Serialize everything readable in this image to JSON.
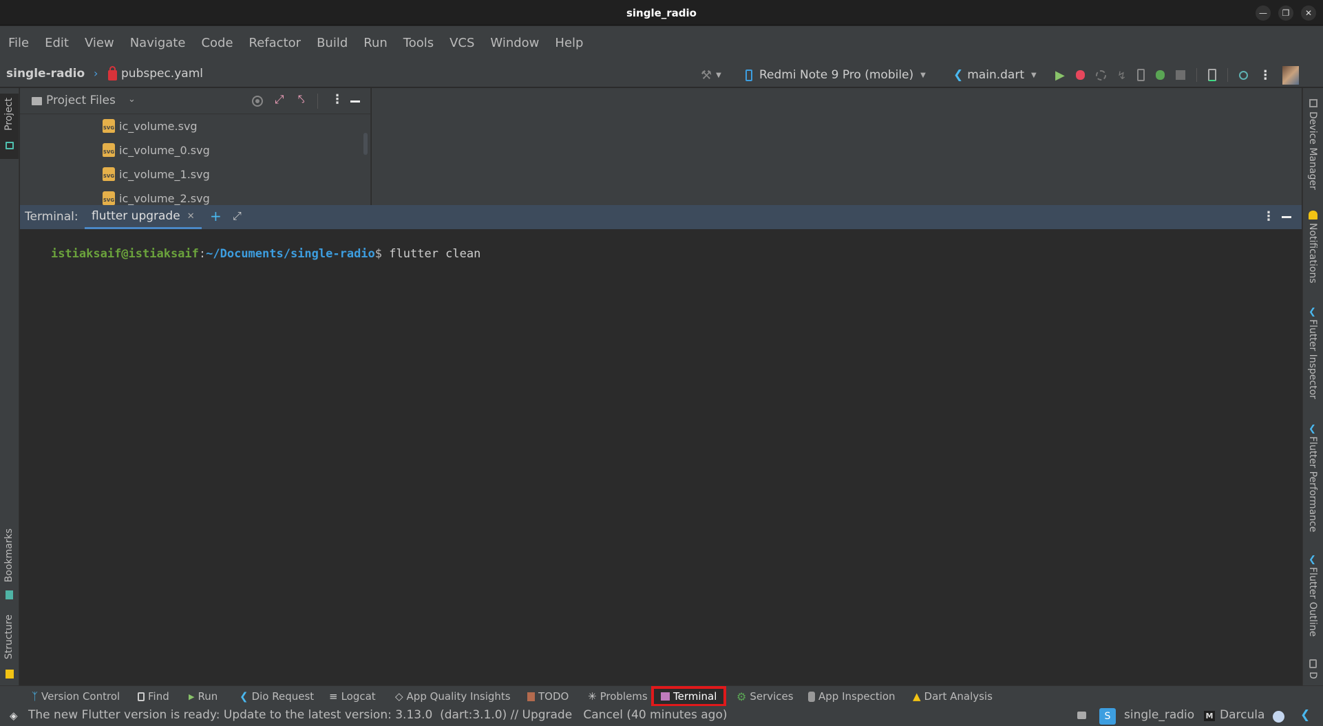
{
  "window": {
    "title": "single_radio",
    "controls": [
      "minimize",
      "restore",
      "close"
    ]
  },
  "menu": [
    "File",
    "Edit",
    "View",
    "Navigate",
    "Code",
    "Refactor",
    "Build",
    "Run",
    "Tools",
    "VCS",
    "Window",
    "Help"
  ],
  "breadcrumb": {
    "project": "single-radio",
    "separator": "›",
    "file": "pubspec.yaml"
  },
  "toolbar": {
    "device": "Redmi Note 9 Pro (mobile)",
    "run_config": "main.dart",
    "icons": [
      "hammer-icon",
      "run-icon",
      "debug-icon",
      "profile-icon",
      "hot-reload-icon",
      "flutter-device-icon",
      "attach-debugger-icon",
      "stop-icon",
      "device-manager-icon",
      "search-icon",
      "more-icon",
      "avatar"
    ]
  },
  "left_strip": {
    "top": [
      {
        "label": "Project",
        "icon": "laptop-icon"
      }
    ],
    "bottom": [
      {
        "label": "Bookmarks",
        "icon": "bookmark-icon"
      },
      {
        "label": "Structure",
        "icon": "structure-icon"
      }
    ]
  },
  "right_strip": [
    {
      "label": "Device Manager",
      "icon": "device-manager-icon"
    },
    {
      "label": "Notifications",
      "icon": "bell-icon"
    },
    {
      "label": "Flutter Inspector",
      "icon": "flutter-icon"
    },
    {
      "label": "Flutter Performance",
      "icon": "flutter-icon"
    },
    {
      "label": "Flutter Outline",
      "icon": "flutter-icon"
    },
    {
      "label": "D",
      "icon": "device-icon"
    }
  ],
  "project_panel": {
    "title": "Project Files",
    "files": [
      "ic_volume.svg",
      "ic_volume_0.svg",
      "ic_volume_1.svg",
      "ic_volume_2.svg"
    ]
  },
  "terminal": {
    "label": "Terminal:",
    "tab": "flutter upgrade",
    "prompt_user": "istiaksaif@istiaksaif",
    "prompt_colon": ":",
    "prompt_path": "~/Documents/single-radio",
    "prompt_dollar": "$",
    "command": "flutter clean"
  },
  "tool_windows": [
    {
      "label": "Version Control",
      "icon": "branch-icon"
    },
    {
      "label": "Find",
      "icon": "find-icon"
    },
    {
      "label": "Run",
      "icon": "run-icon"
    },
    {
      "label": "Dio Request",
      "icon": "flutter-icon"
    },
    {
      "label": "Logcat",
      "icon": "logcat-icon"
    },
    {
      "label": "App Quality Insights",
      "icon": "diamond-icon"
    },
    {
      "label": "TODO",
      "icon": "todo-icon"
    },
    {
      "label": "Problems",
      "icon": "problems-icon"
    },
    {
      "label": "Terminal",
      "icon": "terminal-icon",
      "active": true
    },
    {
      "label": "Services",
      "icon": "gear-icon"
    },
    {
      "label": "App Inspection",
      "icon": "inspection-icon"
    },
    {
      "label": "Dart Analysis",
      "icon": "dart-analysis-icon"
    }
  ],
  "status": {
    "message": "The new Flutter version is ready: Update to the latest version: 3.13.0  (dart:3.1.0) // Upgrade   Cancel (40 minutes ago)",
    "project_badge": "S",
    "project": "single_radio",
    "theme": "Darcula"
  },
  "colors": {
    "highlight_box": "#e0191b",
    "prompt_user": "#6ba33c",
    "prompt_path": "#3d9ee0"
  }
}
